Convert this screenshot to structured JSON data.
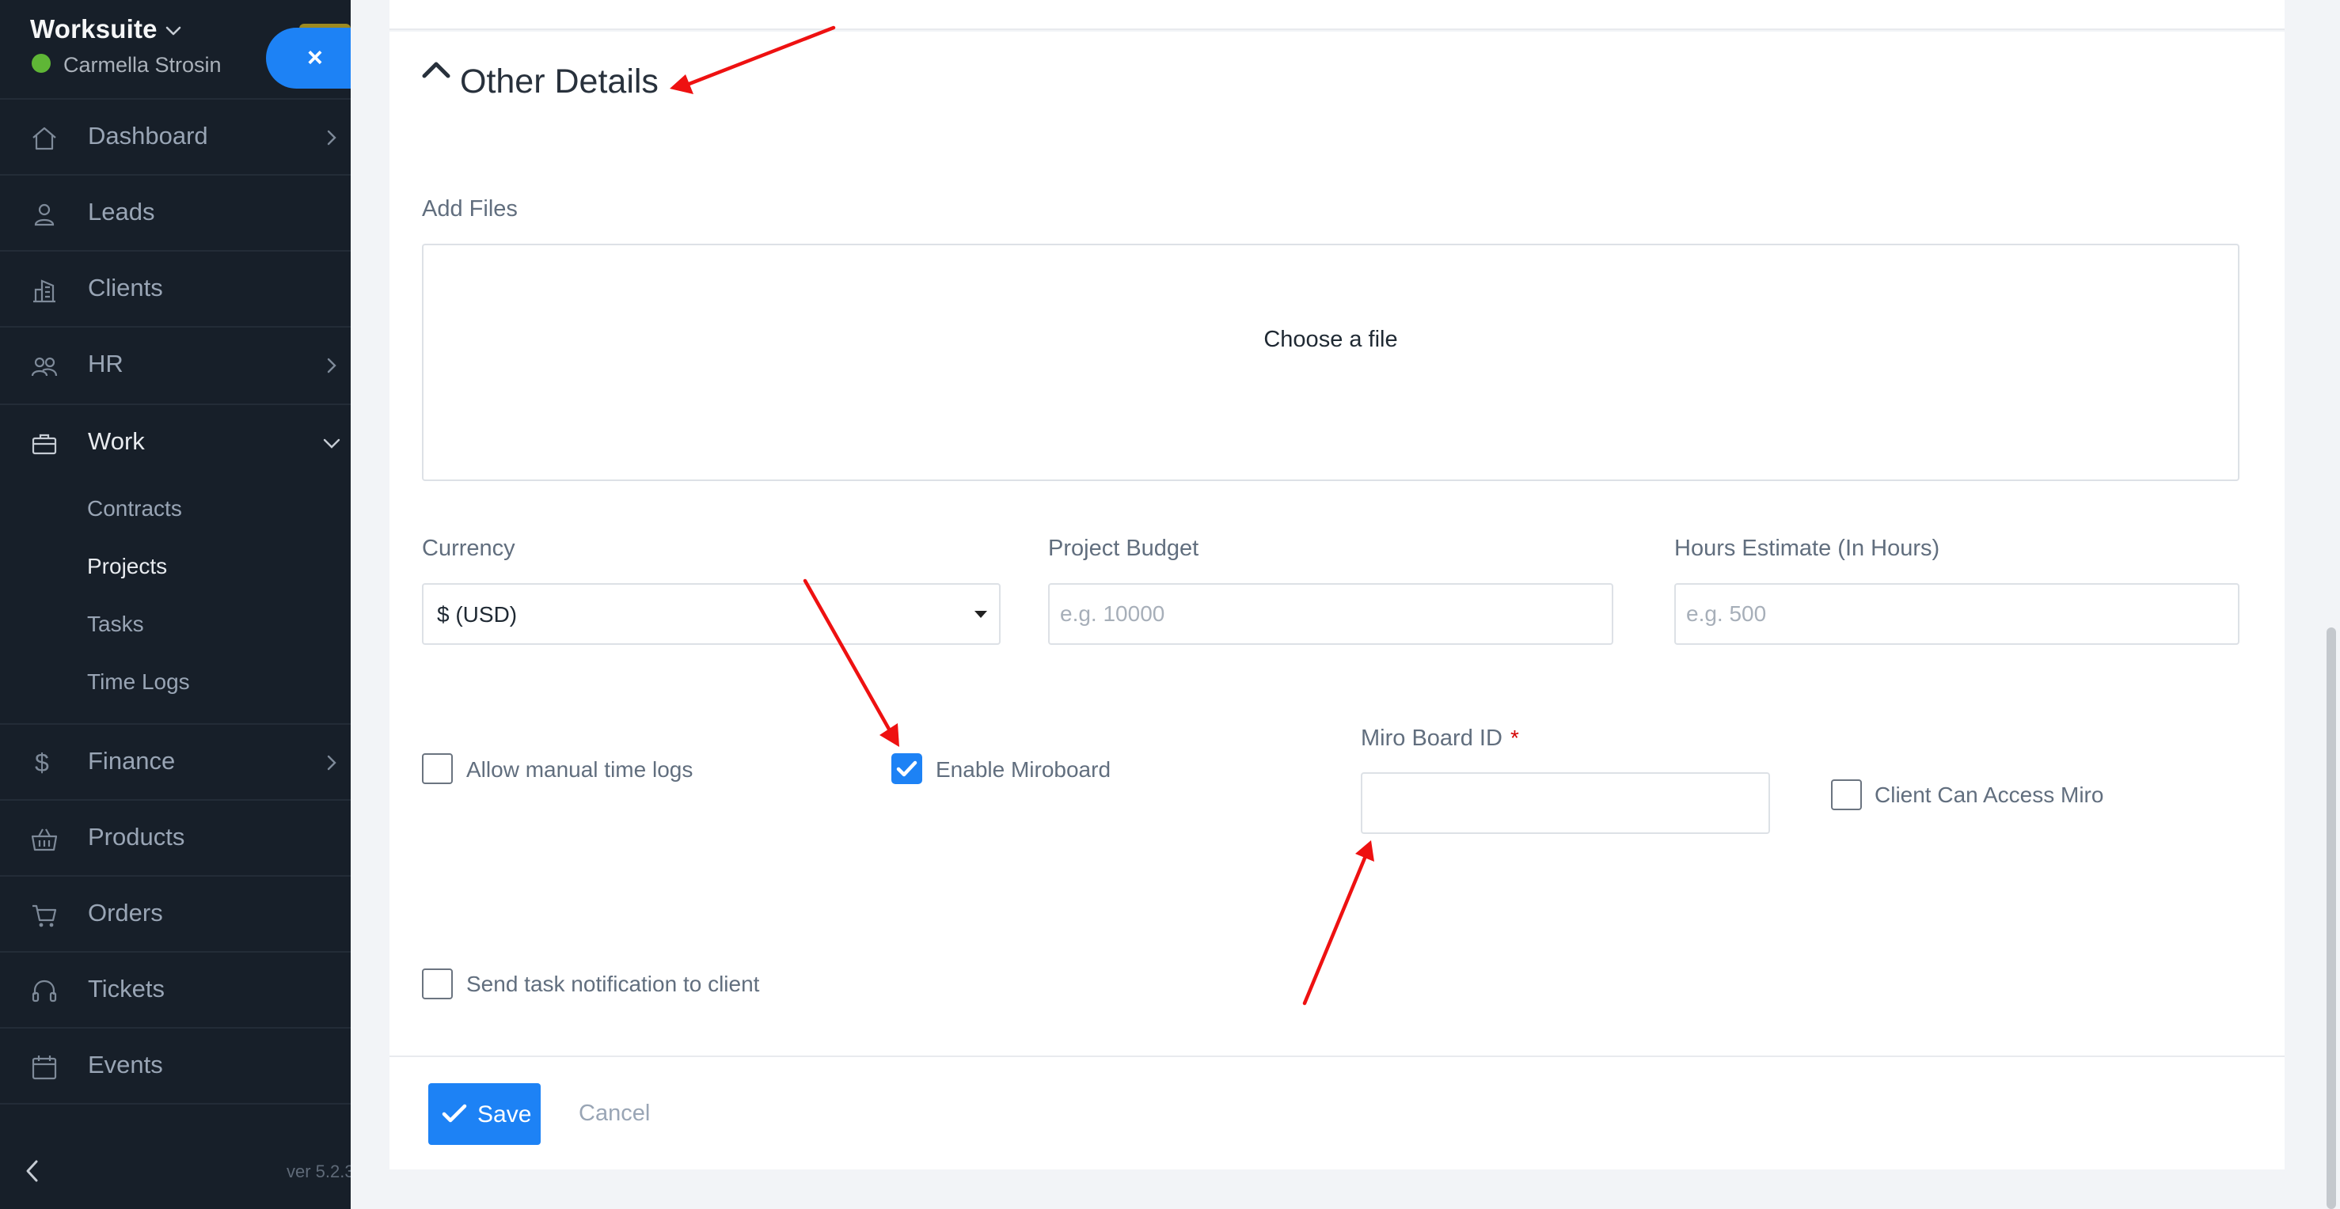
{
  "sidebar": {
    "brand": "Worksuite",
    "user_name": "Carmella Strosin",
    "close_label": "×",
    "nav_items": [
      {
        "label": "Dashboard"
      },
      {
        "label": "Leads"
      },
      {
        "label": "Clients"
      },
      {
        "label": "HR"
      },
      {
        "label": "Work"
      },
      {
        "label": "Finance"
      },
      {
        "label": "Products"
      },
      {
        "label": "Orders"
      },
      {
        "label": "Tickets"
      },
      {
        "label": "Events"
      }
    ],
    "work_submenu": [
      {
        "label": "Contracts"
      },
      {
        "label": "Projects"
      },
      {
        "label": "Tasks"
      },
      {
        "label": "Time Logs"
      }
    ],
    "finance_icon_glyph": "$",
    "version": "ver 5.2.3"
  },
  "form": {
    "section_title": "Other Details",
    "add_files_label": "Add Files",
    "dropzone_text": "Choose a file",
    "currency_label": "Currency",
    "currency_value": "$ (USD)",
    "budget_label": "Project Budget",
    "budget_placeholder": "e.g. 10000",
    "hours_label": "Hours Estimate (In Hours)",
    "hours_placeholder": "e.g. 500",
    "manual_time_label": "Allow manual time logs",
    "manual_time_checked": false,
    "miroboard_label": "Enable Miroboard",
    "miroboard_checked": true,
    "miro_id_label": "Miro Board ID",
    "miro_id_required": "*",
    "client_access_label": "Client Can Access Miro",
    "client_access_checked": false,
    "notify_label": "Send task notification to client",
    "notify_checked": false,
    "save_label": "Save",
    "cancel_label": "Cancel"
  },
  "colors": {
    "sidebar_bg": "#171f29",
    "accent": "#1d82f5",
    "status_online": "#5fb636",
    "required": "#d30000",
    "annotation_arrow": "#ee1111"
  },
  "icons": {
    "dashboard": "home-icon",
    "leads": "person-icon",
    "clients": "building-icon",
    "hr": "people-icon",
    "work": "briefcase-icon",
    "finance": "dollar-icon",
    "products": "basket-icon",
    "orders": "cart-icon",
    "tickets": "headset-icon",
    "events": "calendar-icon"
  }
}
